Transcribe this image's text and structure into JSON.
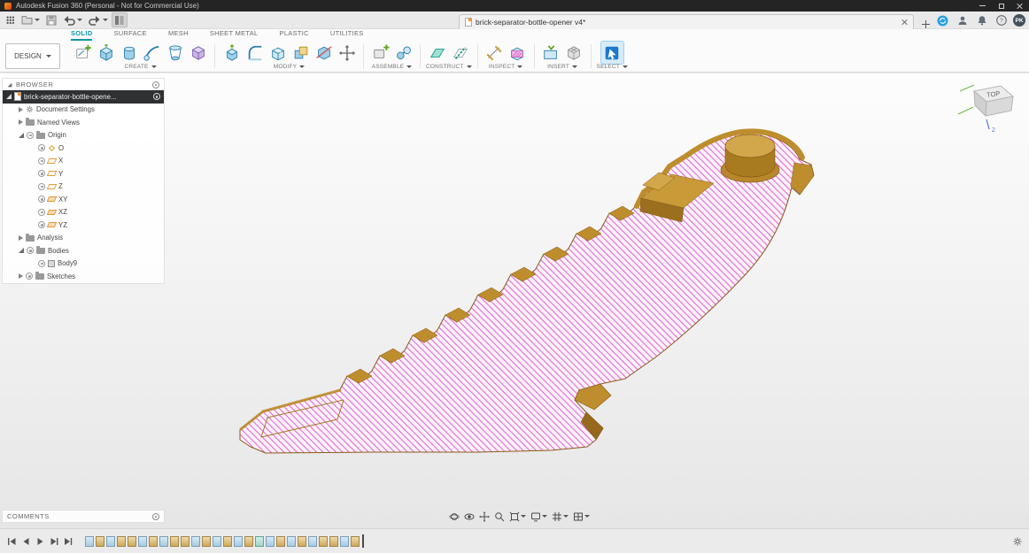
{
  "title_bar": {
    "title": "Autodesk Fusion 360 (Personal - Not for Commercial Use)"
  },
  "app_bar": {
    "tab_title": "brick-separator-bottle-opener v4*",
    "avatar_initials": "PK"
  },
  "ribbon": {
    "design_menu": "DESIGN",
    "tabs": [
      {
        "label": "SOLID"
      },
      {
        "label": "SURFACE"
      },
      {
        "label": "MESH"
      },
      {
        "label": "SHEET METAL"
      },
      {
        "label": "PLASTIC"
      },
      {
        "label": "UTILITIES"
      }
    ],
    "groups": [
      {
        "label": "CREATE"
      },
      {
        "label": "MODIFY"
      },
      {
        "label": "ASSEMBLE"
      },
      {
        "label": "CONSTRUCT"
      },
      {
        "label": "INSPECT"
      },
      {
        "label": "INSERT"
      },
      {
        "label": "SELECT"
      }
    ]
  },
  "browser": {
    "header": "BROWSER",
    "tree": [
      {
        "label": "brick-separator-bottle-opene...",
        "selected": true
      },
      {
        "label": "Document Settings"
      },
      {
        "label": "Named Views"
      },
      {
        "label": "Origin"
      },
      {
        "label": "O"
      },
      {
        "label": "X"
      },
      {
        "label": "Y"
      },
      {
        "label": "Z"
      },
      {
        "label": "XY"
      },
      {
        "label": "XZ"
      },
      {
        "label": "YZ"
      },
      {
        "label": "Analysis"
      },
      {
        "label": "Bodies"
      },
      {
        "label": "Body9"
      },
      {
        "label": "Sketches"
      }
    ]
  },
  "viewcube": {
    "face_label": "TOP",
    "axis_label": "Z"
  },
  "comments": {
    "header": "COMMENTS"
  },
  "timeline": {
    "features": [
      {
        "type": "sketch"
      },
      {
        "type": "feature"
      },
      {
        "type": "sketch"
      },
      {
        "type": "feature"
      },
      {
        "type": "feature"
      },
      {
        "type": "sketch"
      },
      {
        "type": "feature"
      },
      {
        "type": "sketch"
      },
      {
        "type": "feature"
      },
      {
        "type": "feature"
      },
      {
        "type": "sketch"
      },
      {
        "type": "feature"
      },
      {
        "type": "sketch"
      },
      {
        "type": "feature"
      },
      {
        "type": "sketch"
      },
      {
        "type": "feature"
      },
      {
        "type": "construct"
      },
      {
        "type": "sketch"
      },
      {
        "type": "feature"
      },
      {
        "type": "sketch"
      },
      {
        "type": "feature"
      },
      {
        "type": "sketch"
      },
      {
        "type": "feature"
      },
      {
        "type": "feature"
      },
      {
        "type": "sketch"
      },
      {
        "type": "feature"
      }
    ]
  },
  "colors": {
    "accent_teal": "#0a96aa",
    "select_blue": "#1e78c8",
    "body_tan": "#be8d2d",
    "hatch_pink": "#d957c8",
    "origin_orange": "#e59a2e"
  }
}
